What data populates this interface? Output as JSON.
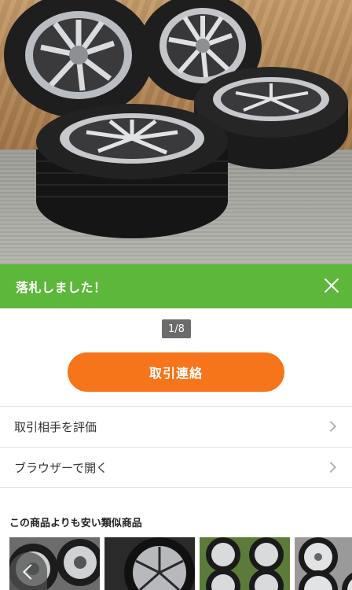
{
  "banner": {
    "text": "落札しました！",
    "close_icon": "close-icon"
  },
  "gallery": {
    "counter": "1/8"
  },
  "actions": {
    "contact_label": "取引連絡"
  },
  "menu": {
    "items": [
      {
        "label": "取引相手を評価",
        "icon": "chevron-right-icon"
      },
      {
        "label": "ブラウザーで開く",
        "icon": "chevron-right-icon"
      }
    ]
  },
  "similar": {
    "title": "この商品よりも安い類似商品"
  },
  "colors": {
    "banner": "#5cb73a",
    "button": "#f6741a",
    "counter_bg": "#6b6b6b"
  }
}
